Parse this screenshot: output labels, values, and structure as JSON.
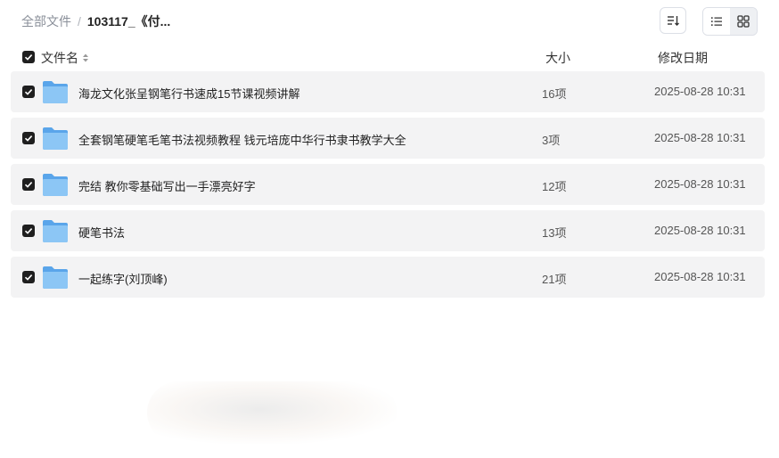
{
  "breadcrumb": {
    "root": "全部文件",
    "separator": "/",
    "current": "103117_《付..."
  },
  "toolbar": {
    "sort_icon": "sort-icon",
    "list_view_icon": "list-view-icon",
    "grid_view_icon": "grid-view-icon"
  },
  "table": {
    "columns": {
      "name": "文件名",
      "size": "大小",
      "date": "修改日期"
    },
    "rows": [
      {
        "name": "海龙文化张呈钢笔行书速成15节课视频讲解",
        "size": "16项",
        "date": "2025-08-28 10:31"
      },
      {
        "name": "全套钢笔硬笔毛笔书法视频教程 钱元培庞中华行书隶书教学大全",
        "size": "3项",
        "date": "2025-08-28 10:31"
      },
      {
        "name": "完结 教你零基础写出一手漂亮好字",
        "size": "12项",
        "date": "2025-08-28 10:31"
      },
      {
        "name": "硬笔书法",
        "size": "13项",
        "date": "2025-08-28 10:31"
      },
      {
        "name": "一起练字(刘顶峰)",
        "size": "21项",
        "date": "2025-08-28 10:31"
      }
    ]
  },
  "colors": {
    "row_bg": "#f3f3f4",
    "checkbox": "#1f1f1f",
    "folder": "#74b5ef"
  }
}
